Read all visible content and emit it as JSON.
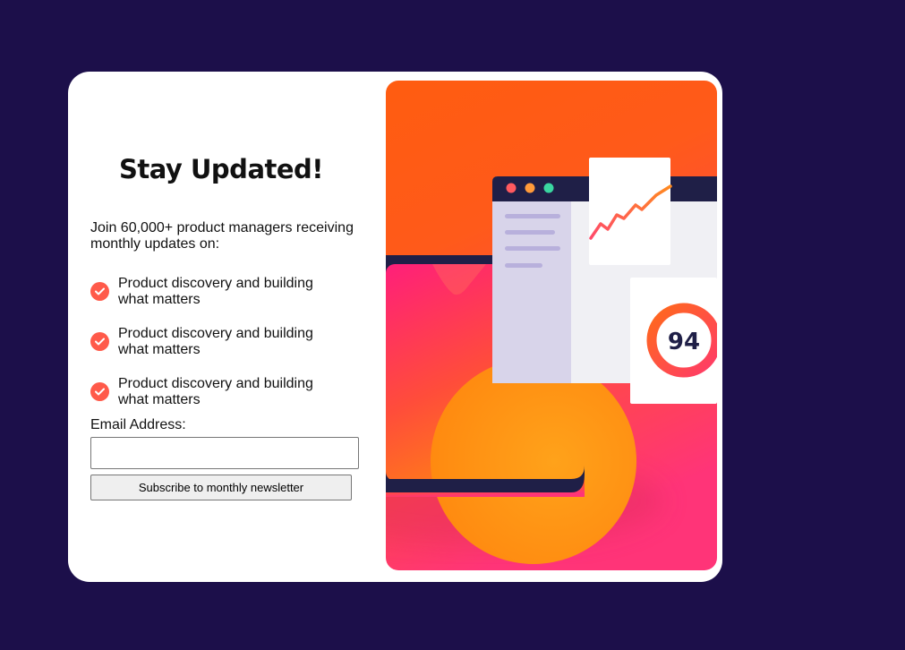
{
  "signup": {
    "title": "Stay Updated!",
    "intro": "Join 60,000+ product managers receiving monthly updates on:",
    "features": [
      {
        "text": "Product discovery and building what matters"
      },
      {
        "text": "Product discovery and building what matters"
      },
      {
        "text": "Product discovery and building what matters"
      }
    ],
    "email_label": "Email Address:",
    "email_value": "",
    "email_placeholder": "",
    "button_label": "Subscribe to monthly newsletter"
  },
  "illustration": {
    "score": "94",
    "colors": {
      "background_top": "#ff6a00",
      "background_bottom": "#ff3a78",
      "accent": "#ff5a4a",
      "dark": "#1f1f47"
    }
  }
}
